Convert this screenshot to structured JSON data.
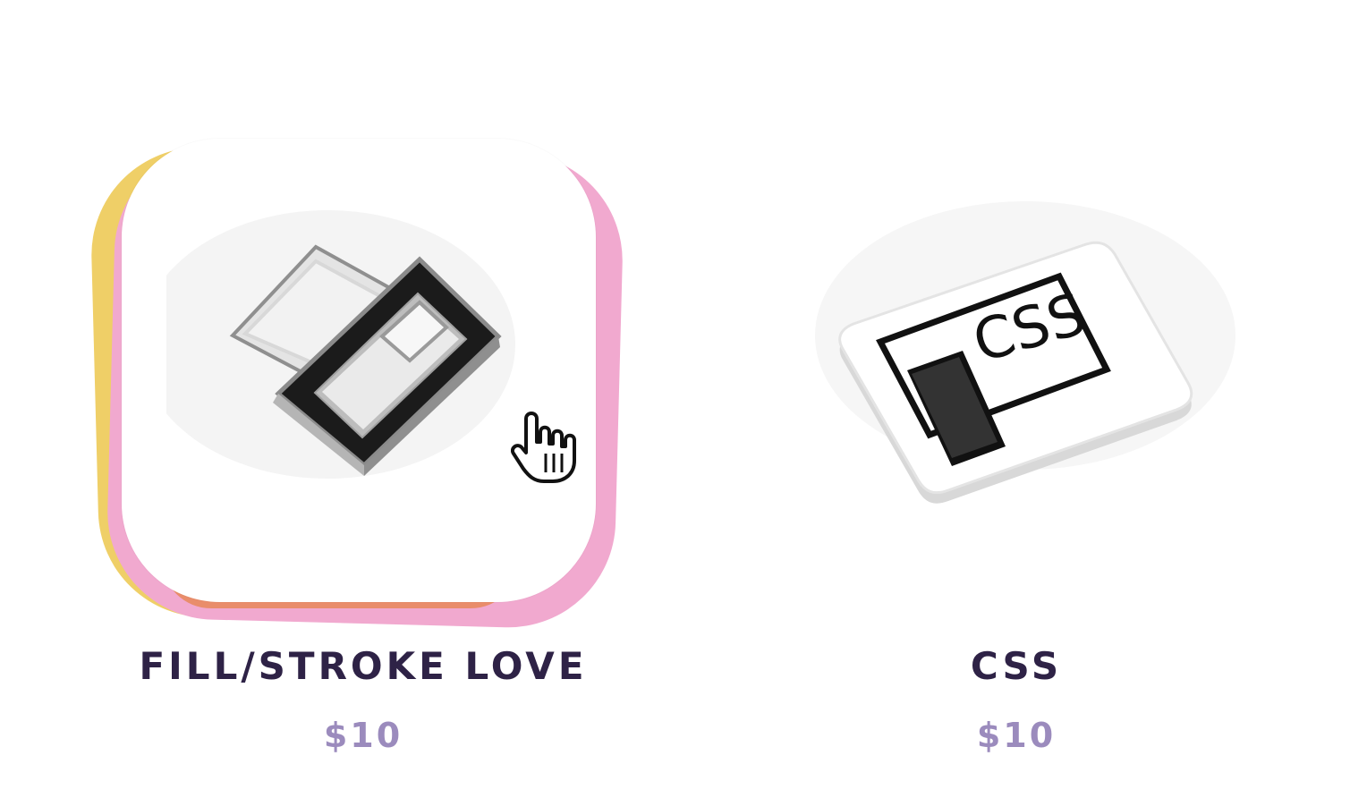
{
  "products": [
    {
      "title": "FILL/STROKE LOVE",
      "price": "$10",
      "image_icon": "heart-pin-icon",
      "highlighted": true
    },
    {
      "title": "CSS",
      "price": "$10",
      "image_icon": "css-pin-icon",
      "highlighted": false
    }
  ],
  "css_pin_text": "CSS",
  "cursor_icon": "hand-cursor-icon",
  "colors": {
    "title": "#2e2246",
    "price": "#9b8bbd",
    "blob_yellow": "#efcf67",
    "blob_pink": "#f1a9cf",
    "blob_orange": "#e8895f"
  }
}
